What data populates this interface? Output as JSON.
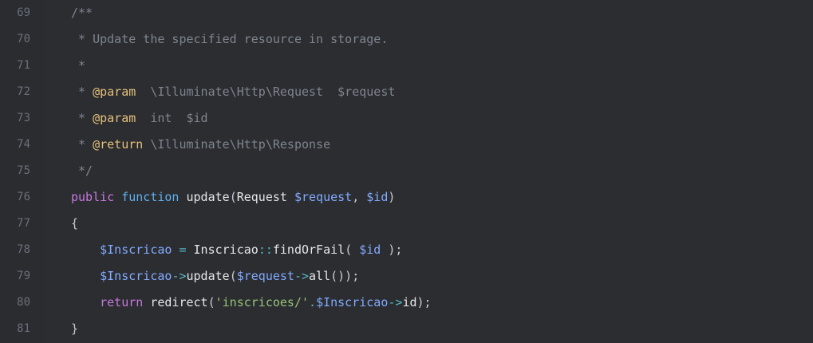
{
  "editor": {
    "lines": [
      {
        "n": "69",
        "tokens": [
          {
            "t": "comment",
            "v": "/**"
          }
        ]
      },
      {
        "n": "70",
        "tokens": [
          {
            "t": "comment",
            "v": " * Update the specified resource in storage."
          }
        ]
      },
      {
        "n": "71",
        "tokens": [
          {
            "t": "comment",
            "v": " *"
          }
        ]
      },
      {
        "n": "72",
        "tokens": [
          {
            "t": "comment",
            "v": " * "
          },
          {
            "t": "doc-tag",
            "v": "@param"
          },
          {
            "t": "comment",
            "v": "  \\Illuminate\\Http\\Request  $request"
          }
        ]
      },
      {
        "n": "73",
        "tokens": [
          {
            "t": "comment",
            "v": " * "
          },
          {
            "t": "doc-tag",
            "v": "@param"
          },
          {
            "t": "comment",
            "v": "  int  $id"
          }
        ]
      },
      {
        "n": "74",
        "tokens": [
          {
            "t": "comment",
            "v": " * "
          },
          {
            "t": "doc-tag",
            "v": "@return"
          },
          {
            "t": "comment",
            "v": " \\Illuminate\\Http\\Response"
          }
        ]
      },
      {
        "n": "75",
        "tokens": [
          {
            "t": "comment",
            "v": " */"
          }
        ]
      },
      {
        "n": "76",
        "tokens": [
          {
            "t": "keyword",
            "v": "public"
          },
          {
            "t": "plain",
            "v": " "
          },
          {
            "t": "keyword2",
            "v": "function"
          },
          {
            "t": "plain",
            "v": " "
          },
          {
            "t": "fn",
            "v": "update"
          },
          {
            "t": "punc",
            "v": "("
          },
          {
            "t": "class",
            "v": "Request"
          },
          {
            "t": "plain",
            "v": " "
          },
          {
            "t": "var",
            "v": "$request"
          },
          {
            "t": "punc",
            "v": ", "
          },
          {
            "t": "var",
            "v": "$id"
          },
          {
            "t": "punc",
            "v": ")"
          }
        ]
      },
      {
        "n": "77",
        "tokens": [
          {
            "t": "punc",
            "v": "{"
          }
        ]
      },
      {
        "n": "78",
        "tokens": [
          {
            "t": "plain",
            "v": "    "
          },
          {
            "t": "var",
            "v": "$Inscricao"
          },
          {
            "t": "op",
            "v": " = "
          },
          {
            "t": "class",
            "v": "Inscricao"
          },
          {
            "t": "op",
            "v": "::"
          },
          {
            "t": "fn",
            "v": "findOrFail"
          },
          {
            "t": "punc",
            "v": "( "
          },
          {
            "t": "var",
            "v": "$id"
          },
          {
            "t": "punc",
            "v": " );"
          }
        ]
      },
      {
        "n": "79",
        "tokens": [
          {
            "t": "plain",
            "v": "    "
          },
          {
            "t": "var",
            "v": "$Inscricao"
          },
          {
            "t": "op",
            "v": "->"
          },
          {
            "t": "fn",
            "v": "update"
          },
          {
            "t": "punc",
            "v": "("
          },
          {
            "t": "var",
            "v": "$request"
          },
          {
            "t": "op",
            "v": "->"
          },
          {
            "t": "fn",
            "v": "all"
          },
          {
            "t": "punc",
            "v": "());"
          }
        ]
      },
      {
        "n": "80",
        "tokens": [
          {
            "t": "plain",
            "v": "    "
          },
          {
            "t": "keyword",
            "v": "return"
          },
          {
            "t": "plain",
            "v": " "
          },
          {
            "t": "fn",
            "v": "redirect"
          },
          {
            "t": "punc",
            "v": "("
          },
          {
            "t": "str",
            "v": "'inscricoes/'"
          },
          {
            "t": "op",
            "v": "."
          },
          {
            "t": "var",
            "v": "$Inscricao"
          },
          {
            "t": "op",
            "v": "->"
          },
          {
            "t": "fn",
            "v": "id"
          },
          {
            "t": "punc",
            "v": ");"
          }
        ]
      },
      {
        "n": "81",
        "tokens": [
          {
            "t": "punc",
            "v": "}"
          }
        ]
      }
    ]
  }
}
